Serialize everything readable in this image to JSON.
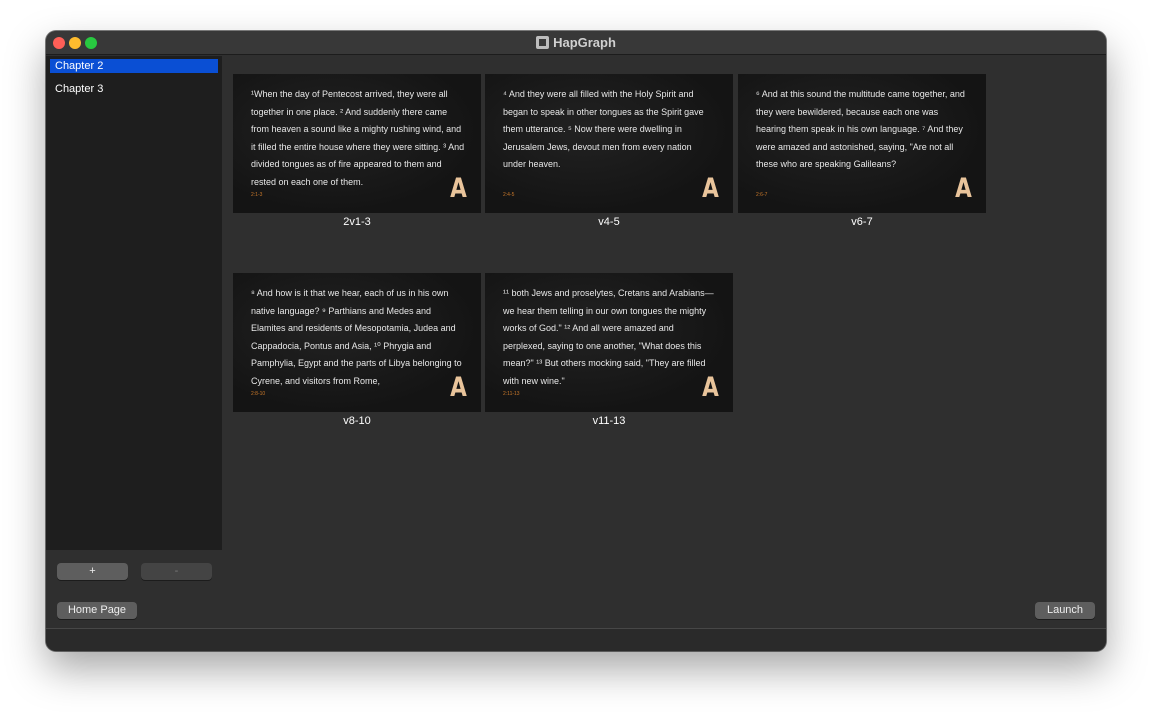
{
  "window": {
    "title": "HapGraph"
  },
  "sidebar": {
    "items": [
      {
        "label": "Chapter 2",
        "selected": true
      },
      {
        "label": "Chapter 3",
        "selected": false
      }
    ],
    "add_label": "+",
    "remove_label": "-"
  },
  "footer": {
    "home_label": "Home Page",
    "launch_label": "Launch"
  },
  "slides": [
    {
      "text": "¹When the day of Pentecost arrived, they were all together in one place. ² And suddenly there came from heaven a sound like a mighty rushing wind, and it filled the entire house where they were sitting. ³ And divided tongues as of fire appeared to them and rested on each one of them.",
      "ref": "2:1-3",
      "logo": "A",
      "caption": "2v1-3"
    },
    {
      "text": "⁴ And they were all filled with the Holy Spirit and began to speak in other tongues as the Spirit gave them utterance. ⁵ Now there were dwelling in Jerusalem Jews, devout men from every nation under heaven.",
      "ref": "2:4-5",
      "logo": "A",
      "caption": "v4-5"
    },
    {
      "text": "⁶ And at this sound the multitude came together, and they were bewildered, because each one was hearing them speak in his own language. ⁷ And they were amazed and astonished, saying, \"Are not all these who are speaking Galileans?",
      "ref": "2:6-7",
      "logo": "A",
      "caption": "v6-7"
    },
    {
      "text": "⁸ And how is it that we hear, each of us in his own native language? ⁹ Parthians and Medes and Elamites and residents of Mesopotamia, Judea and Cappadocia, Pontus and Asia, ¹⁰ Phrygia and Pamphylia, Egypt and the parts of Libya belonging to Cyrene, and visitors from Rome,",
      "ref": "2:8-10",
      "logo": "A",
      "caption": "v8-10"
    },
    {
      "text": "¹¹ both Jews and proselytes, Cretans and Arabians—we hear them telling in our own tongues the mighty works of God.\" ¹² And all were amazed and perplexed, saying to one another, \"What does this mean?\" ¹³ But others mocking said, \"They are filled with new wine.\"",
      "ref": "2:11-13",
      "logo": "A",
      "caption": "v11-13"
    }
  ]
}
